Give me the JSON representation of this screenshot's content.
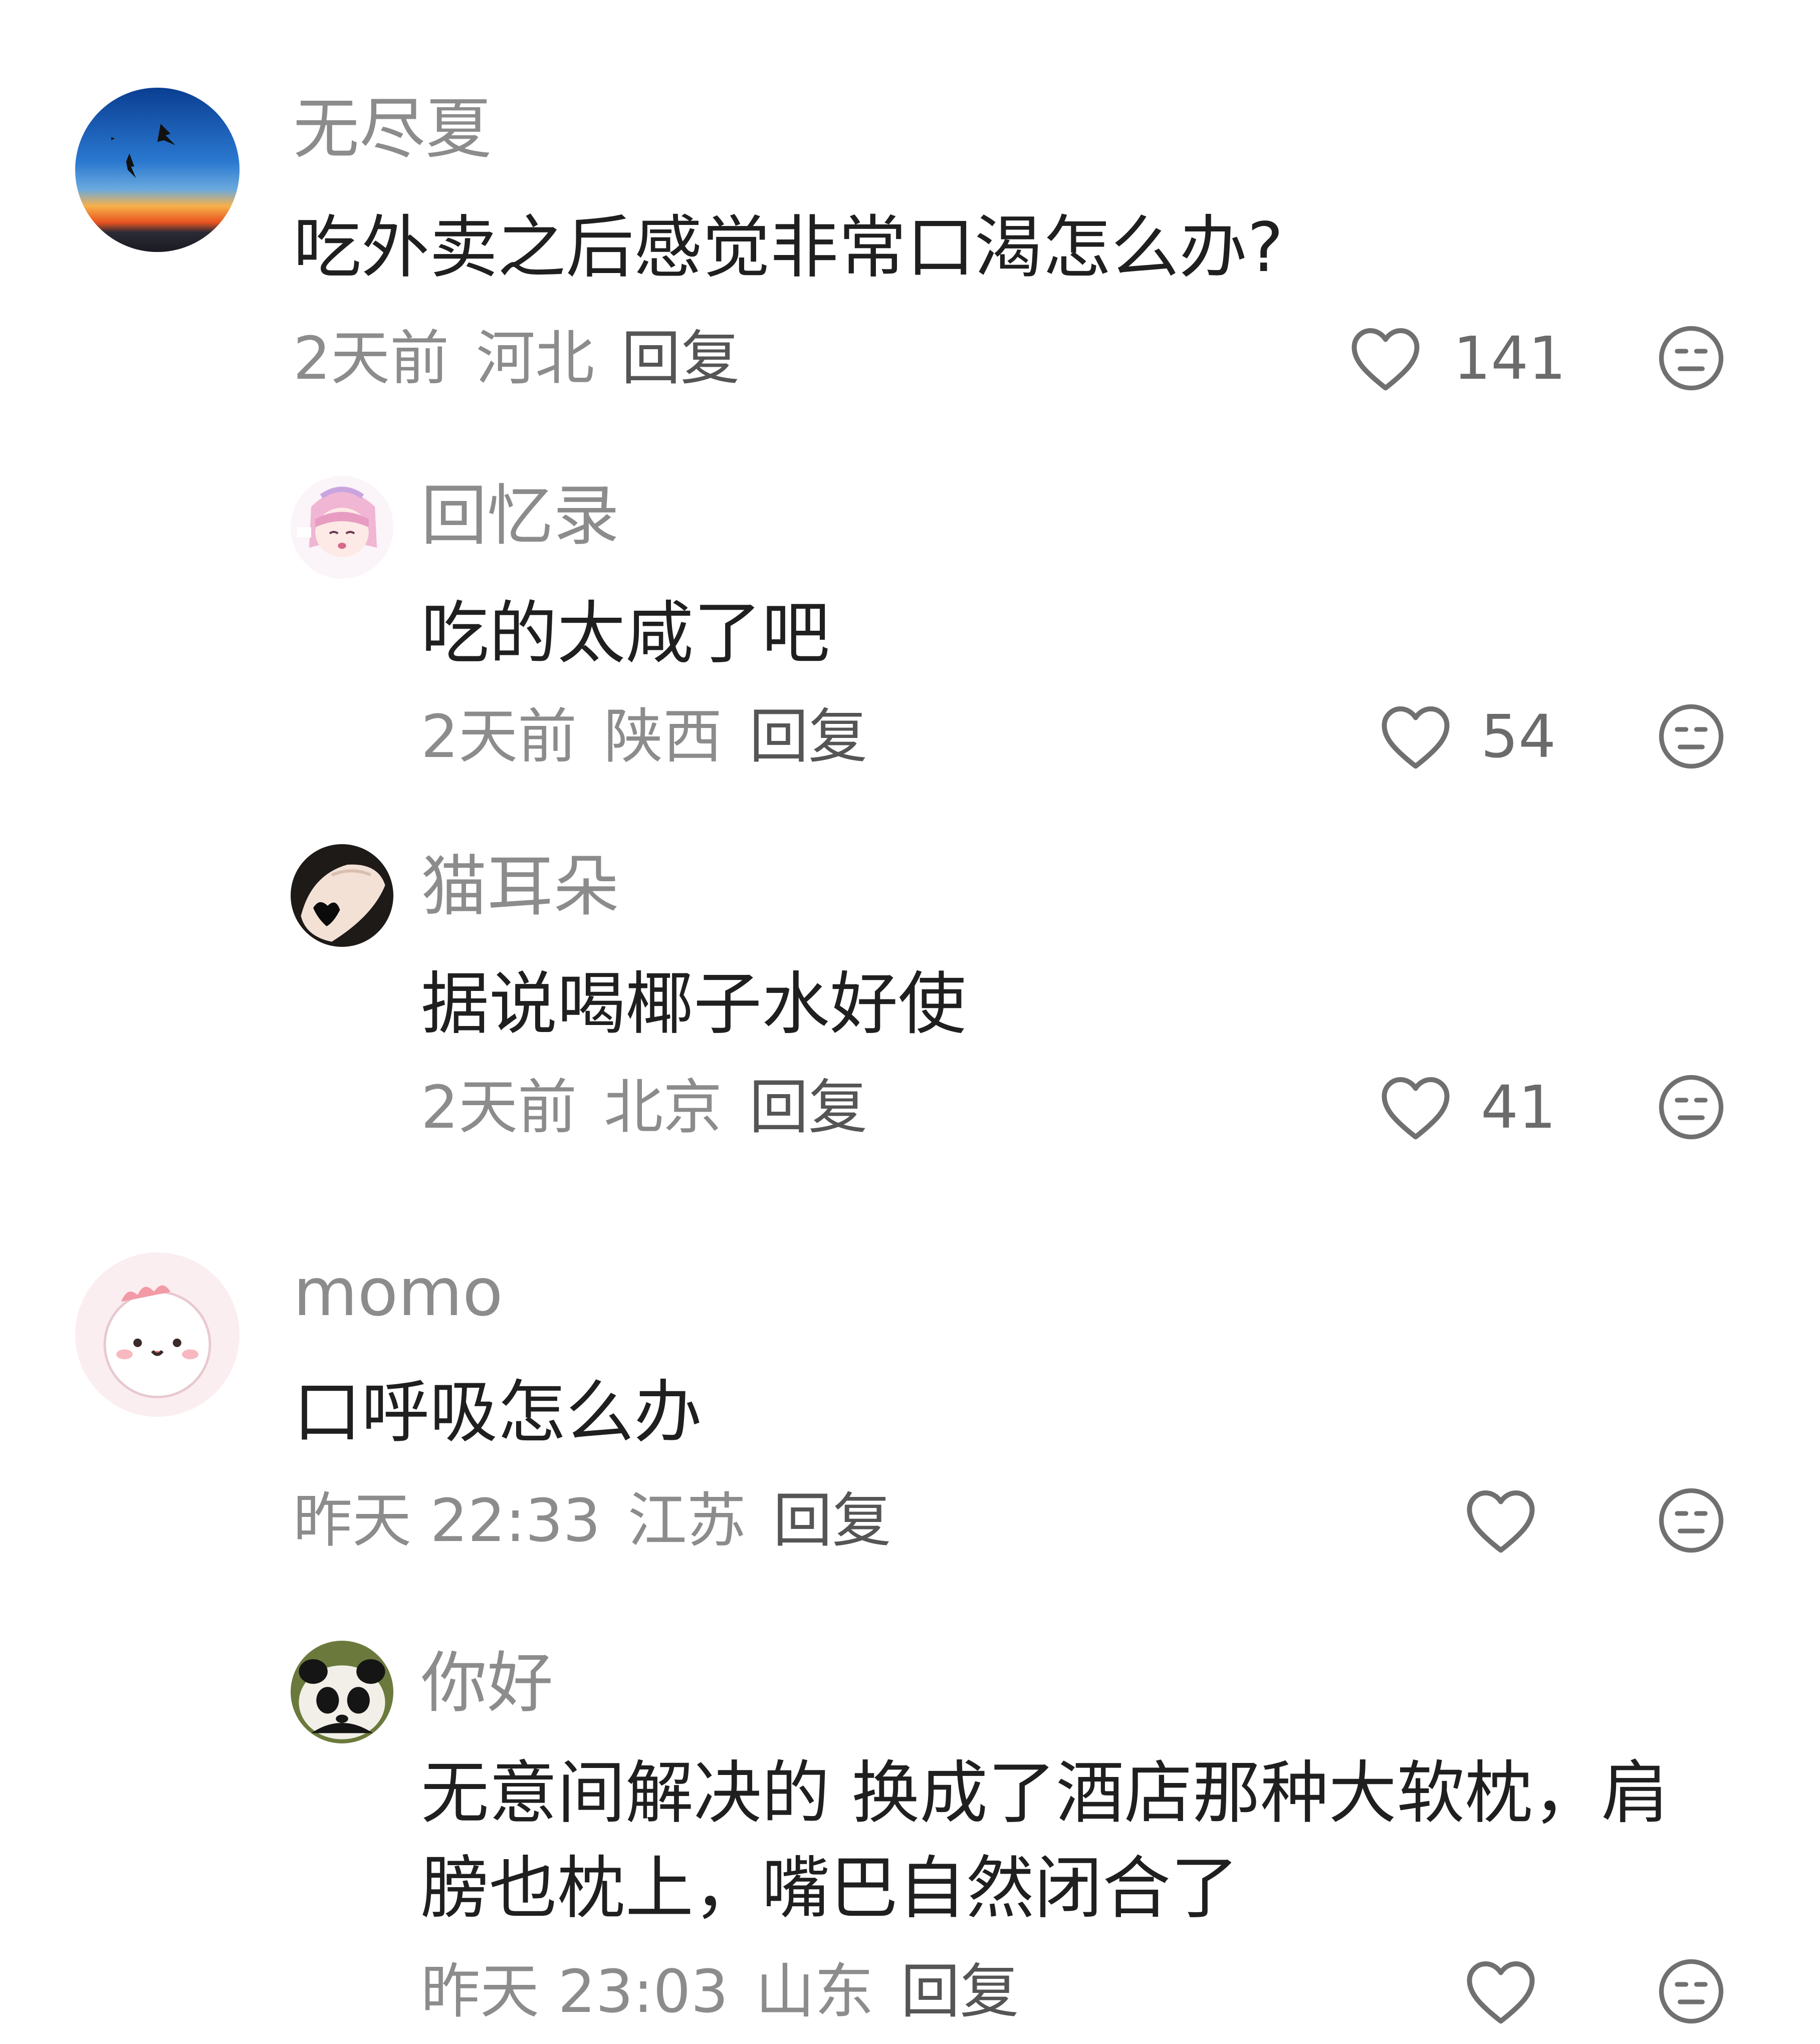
{
  "colors": {
    "username": "#8c8c8c",
    "body_text": "#1f1f1f",
    "meta": "#8c8c8c",
    "reply": "#555555",
    "icon": "#707070"
  },
  "comments": [
    {
      "username": "无尽夏",
      "text": "吃外卖之后感觉非常口渴怎么办?",
      "time": "2天前",
      "location": "河北",
      "reply_label": "回复",
      "likes": "141",
      "avatar": "sunset-birds-avatar"
    },
    {
      "username": "回忆录",
      "text": "吃的太咸了吧",
      "time": "2天前",
      "location": "陕西",
      "reply_label": "回复",
      "likes": "54",
      "avatar": "anime-girl-avatar"
    },
    {
      "username": "猫耳朵",
      "text": "据说喝椰子水好使",
      "time": "2天前",
      "location": "北京",
      "reply_label": "回复",
      "likes": "41",
      "avatar": "hand-heart-avatar"
    },
    {
      "username": "momo",
      "text": "口呼吸怎么办",
      "time": "昨天 22:33",
      "location": "江苏",
      "reply_label": "回复",
      "likes": "",
      "avatar": "pink-cartoon-avatar"
    },
    {
      "username": "你好",
      "text": "无意间解决的 换成了酒店那种大软枕，肩膀也枕上，嘴巴自然闭合了",
      "time": "昨天 23:03",
      "location": "山东",
      "reply_label": "回复",
      "likes": "",
      "avatar": "panda-avatar"
    }
  ],
  "icons": {
    "like": "heart-outline-icon",
    "dislike": "neutral-face-icon"
  }
}
